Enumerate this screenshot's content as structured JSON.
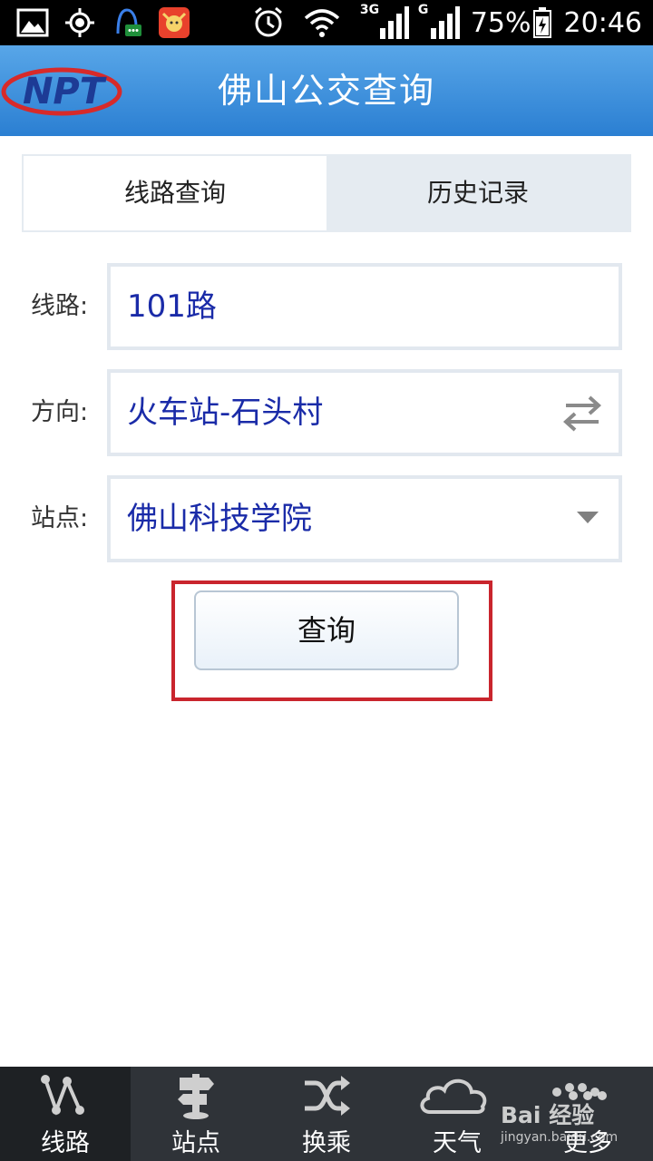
{
  "status_bar": {
    "battery": "75%",
    "time": "20:46",
    "network_3g": "3G",
    "network_g": "G",
    "icons": [
      "image-icon",
      "gps-icon",
      "chat-icon",
      "app-icon",
      "alarm-icon",
      "wifi-icon",
      "signal-icon",
      "battery-icon"
    ]
  },
  "header": {
    "logo_text": "NPT",
    "title": "佛山公交查询",
    "color": "#3b8fdc"
  },
  "tabs": [
    {
      "label": "线路查询",
      "active": true
    },
    {
      "label": "历史记录",
      "active": false
    }
  ],
  "form": {
    "route": {
      "label": "线路:",
      "value": "101路"
    },
    "direction": {
      "label": "方向:",
      "value": "火车站-石头村",
      "icon": "swap-icon"
    },
    "station": {
      "label": "站点:",
      "value": "佛山科技学院",
      "icon": "dropdown-icon"
    }
  },
  "query_button": {
    "label": "查询"
  },
  "highlight_color": "#c9252d",
  "bottom_nav": [
    {
      "label": "线路",
      "icon": "route-icon",
      "active": true
    },
    {
      "label": "站点",
      "icon": "signpost-icon",
      "active": false
    },
    {
      "label": "换乘",
      "icon": "shuffle-icon",
      "active": false
    },
    {
      "label": "天气",
      "icon": "cloud-icon",
      "active": false
    },
    {
      "label": "更多",
      "icon": "more-icon",
      "active": false
    }
  ],
  "watermark": {
    "text": "Bai 经验",
    "sub": "jingyan.baidu.com"
  }
}
